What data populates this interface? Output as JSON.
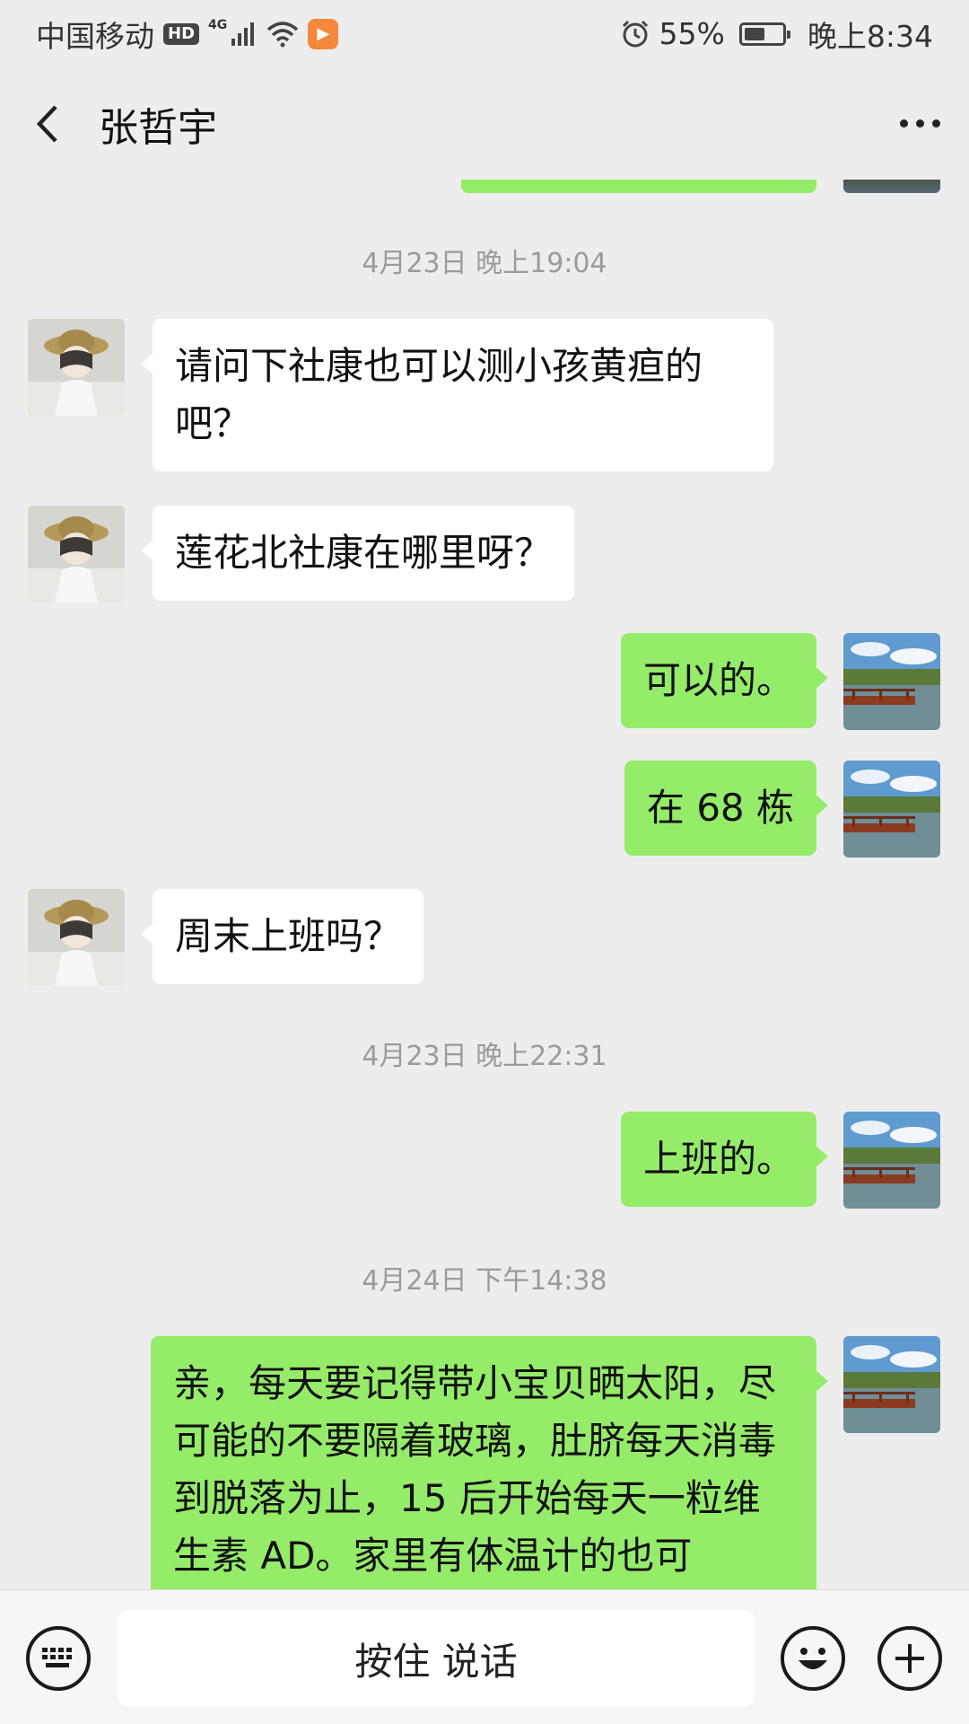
{
  "status_bar": {
    "carrier": "中国移动",
    "hd": "HD",
    "network": "4G",
    "battery_percent": "55%",
    "battery_level": 0.55,
    "time": "晚上8:34"
  },
  "nav": {
    "title": "张哲宇"
  },
  "messages": [
    {
      "type": "time",
      "text": "4月23日 晚上19:04"
    },
    {
      "type": "in",
      "text": "请问下社康也可以测小孩黄疸的吧？"
    },
    {
      "type": "in",
      "text": "莲花北社康在哪里呀？"
    },
    {
      "type": "out",
      "text": "可以的。"
    },
    {
      "type": "out",
      "text": "在 68 栋"
    },
    {
      "type": "in",
      "text": "周末上班吗？"
    },
    {
      "type": "time",
      "text": "4月23日 晚上22:31"
    },
    {
      "type": "out",
      "text": "上班的。"
    },
    {
      "type": "time",
      "text": "4月24日 下午14:38"
    },
    {
      "type": "out",
      "text": "亲，每天要记得带小宝贝晒太阳，尽可能的不要隔着玻璃，肚脐每天消毒到脱落为止，15 后开始每天一粒维生素 AD。家里有体温计的也可"
    }
  ],
  "input_bar": {
    "hold_to_talk": "按住 说话"
  },
  "icons": {
    "back": "chevron-left-icon",
    "more": "more-dots-icon",
    "keyboard": "keyboard-icon",
    "emoji": "emoji-icon",
    "plus": "plus-icon",
    "alarm": "alarm-icon",
    "wifi": "wifi-icon",
    "signal": "signal-icon"
  },
  "colors": {
    "background": "#ededed",
    "outgoing_bubble": "#95ec69",
    "incoming_bubble": "#ffffff",
    "timestamp": "#9b9b9b"
  }
}
